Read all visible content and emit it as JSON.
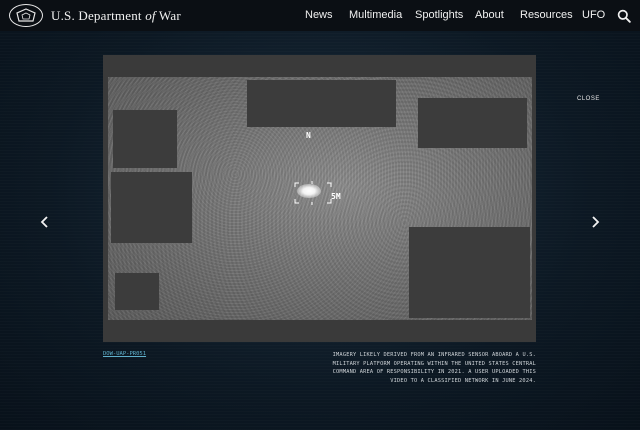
{
  "header": {
    "brand_prefix": "U.S. Department ",
    "brand_italic": "of",
    "brand_suffix": " War",
    "nav": [
      "News",
      "Multimedia",
      "Spotlights",
      "About",
      "Resources",
      "UFO"
    ],
    "search_icon": "search-icon",
    "logo_icon": "pentagon-seal-icon"
  },
  "viewer": {
    "close_label": "CLOSE",
    "prev_icon": "chevron-left-icon",
    "next_icon": "chevron-right-icon",
    "hud_heading": "N",
    "hud_target_label": "5M",
    "media_id": "DOW-UAP-PR051",
    "caption": "IMAGERY LIKELY DERIVED FROM AN INFRARED SENSOR ABOARD A U.S. MILITARY PLATFORM OPERATING WITHIN THE UNITED STATES CENTRAL COMMAND AREA OF RESPONSIBILITY IN 2021. A USER UPLOADED THIS VIDEO TO A CLASSIFIED NETWORK IN JUNE 2024."
  },
  "colors": {
    "header_bg": "#0b0f14",
    "page_bg": "#0b1520",
    "link": "#5fb0cc",
    "redaction": "#3c3c3c"
  }
}
